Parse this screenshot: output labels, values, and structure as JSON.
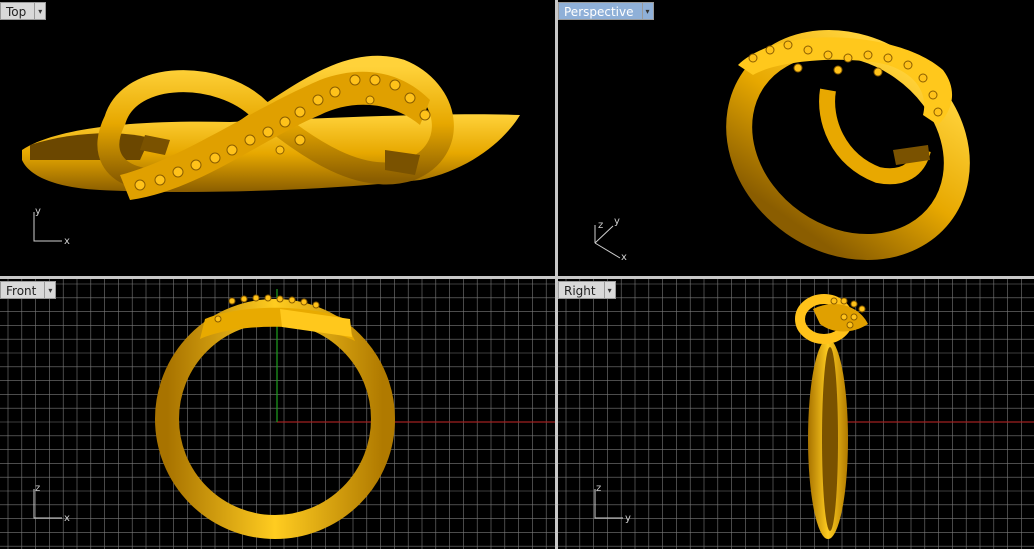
{
  "viewports": {
    "top": {
      "label": "Top",
      "axis_a": "y",
      "axis_b": "x"
    },
    "perspective": {
      "label": "Perspective",
      "axis_a": "z",
      "axis_b": "y",
      "axis_c": "x"
    },
    "front": {
      "label": "Front",
      "axis_a": "z",
      "axis_b": "x"
    },
    "right": {
      "label": "Right",
      "axis_a": "z",
      "axis_b": "y"
    }
  },
  "active_viewport": "Perspective",
  "dropdown_glyph": "▾",
  "colors": {
    "viewport_bg": "#000000",
    "model_gold": "#f0b400",
    "grid_line": "#7a7a7a",
    "axis_x": "#a02020",
    "axis_y": "#20a020",
    "active_tab": "#8fb0d8"
  }
}
